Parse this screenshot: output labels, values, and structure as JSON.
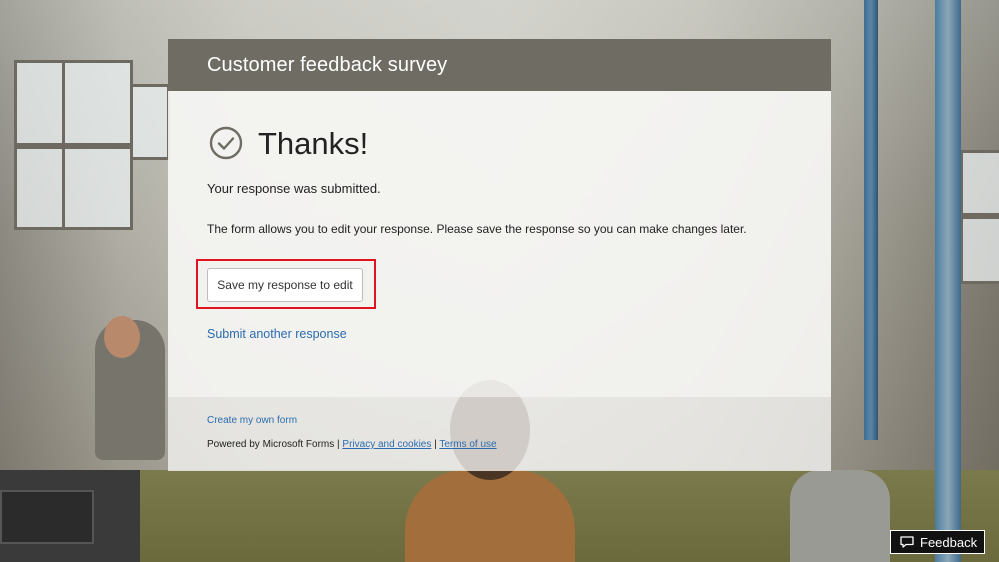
{
  "form": {
    "title": "Customer feedback survey"
  },
  "confirmation": {
    "heading": "Thanks!",
    "submitted_message": "Your response was submitted.",
    "edit_info": "The form allows you to edit your response. Please save the response so you can make changes later.",
    "save_button_label": "Save my response to edit",
    "submit_another_label": "Submit another response",
    "icon": "check-circle-icon"
  },
  "footer": {
    "create_form_label": "Create my own form",
    "powered_by": "Powered by Microsoft Forms |",
    "privacy_label": "Privacy and cookies",
    "separator": "|",
    "terms_label": "Terms of use"
  },
  "feedback": {
    "label": "Feedback",
    "icon": "speech-bubble-icon"
  },
  "colors": {
    "header": "#6e6c63",
    "link": "#2b6cb0",
    "highlight": "#e0141e"
  }
}
